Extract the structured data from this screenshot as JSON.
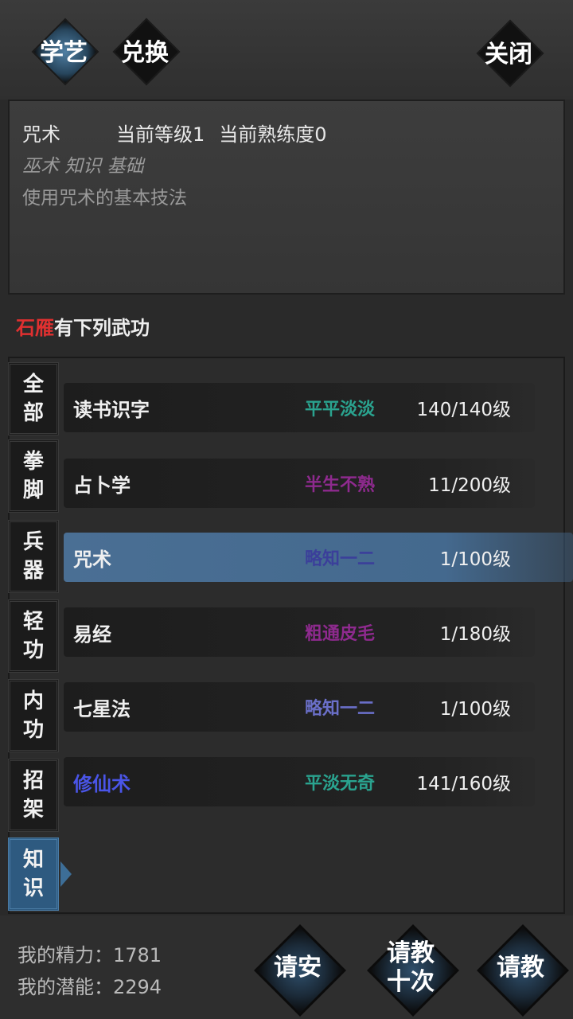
{
  "tabs": [
    {
      "label": "学艺",
      "active": true
    },
    {
      "label": "兑换",
      "active": false
    }
  ],
  "close_label": "关闭",
  "skill_info": {
    "name": "咒术",
    "level_text": "当前等级1",
    "proficiency_text": "当前熟练度0",
    "tags": "巫术 知识 基础",
    "description": "使用咒术的基本技法"
  },
  "owner": {
    "name": "石雁",
    "suffix": "有下列武功"
  },
  "categories": [
    {
      "line1": "全",
      "line2": "部"
    },
    {
      "line1": "拳",
      "line2": "脚"
    },
    {
      "line1": "兵",
      "line2": "器"
    },
    {
      "line1": "轻",
      "line2": "功"
    },
    {
      "line1": "内",
      "line2": "功"
    },
    {
      "line1": "招",
      "line2": "架"
    },
    {
      "line1": "知",
      "line2": "识"
    }
  ],
  "skills": [
    {
      "name": "读书识字",
      "level": "平平淡淡",
      "progress": "140/140级",
      "name_color": "#f0f0f0",
      "level_color": "#2aa38f"
    },
    {
      "name": "占卜学",
      "level": "半生不熟",
      "progress": "11/200级",
      "name_color": "#f0f0f0",
      "level_color": "#8e2a8e"
    },
    {
      "name": "咒术",
      "level": "略知一二",
      "progress": "1/100级",
      "name_color": "#f0f0f0",
      "level_color": "#3b3f9a"
    },
    {
      "name": "易经",
      "level": "粗通皮毛",
      "progress": "1/180级",
      "name_color": "#f0f0f0",
      "level_color": "#8e2a8e"
    },
    {
      "name": "七星法",
      "level": "略知一二",
      "progress": "1/100级",
      "name_color": "#f0f0f0",
      "level_color": "#6a6fc8"
    },
    {
      "name": "修仙术",
      "level": "平淡无奇",
      "progress": "141/160级",
      "name_color": "#4a55e8",
      "level_color": "#2aa38f"
    }
  ],
  "stats": {
    "energy_label": "我的精力：",
    "energy_value": "1781",
    "potential_label": "我的潜能：",
    "potential_value": "2294"
  },
  "actions": {
    "greet": "请安",
    "ten_line1": "请教",
    "ten_line2": "十次",
    "ask": "请教"
  }
}
